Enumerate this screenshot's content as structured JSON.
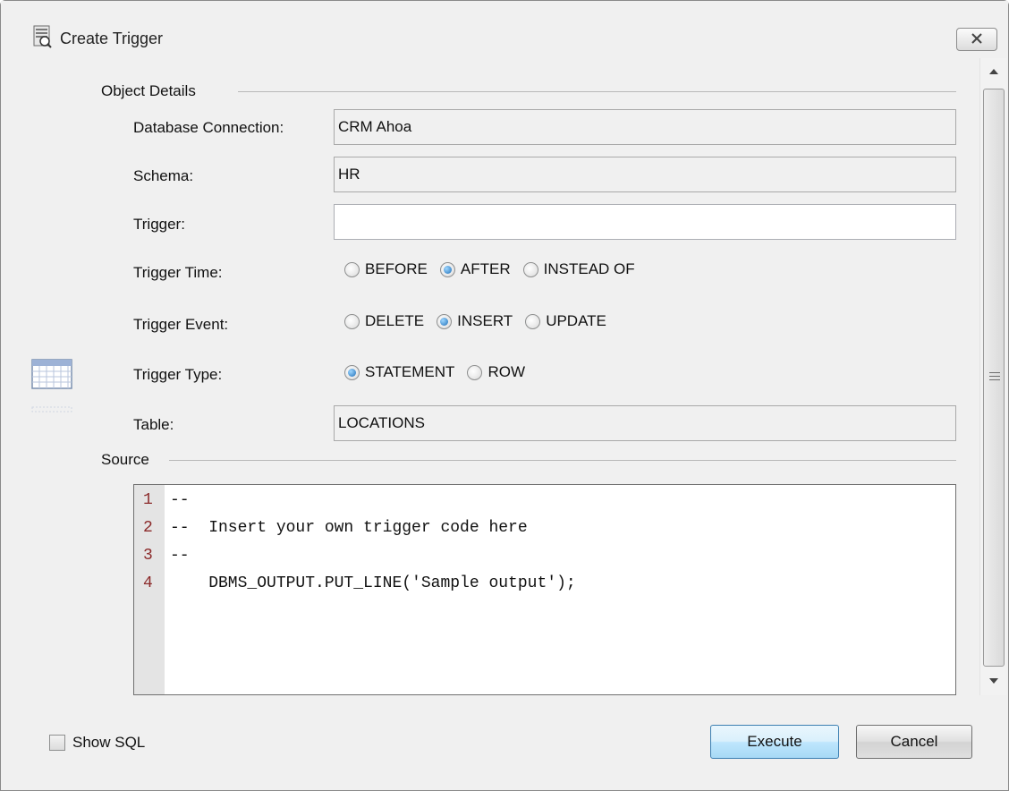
{
  "window": {
    "title": "Create Trigger"
  },
  "object_details": {
    "section_title": "Object Details",
    "database_connection": {
      "label": "Database Connection:",
      "value": "CRM Ahoa"
    },
    "schema": {
      "label": "Schema:",
      "value": "HR"
    },
    "trigger": {
      "label": "Trigger:",
      "value": ""
    },
    "trigger_time": {
      "label": "Trigger Time:",
      "options": [
        "BEFORE",
        "AFTER",
        "INSTEAD OF"
      ],
      "selected": "AFTER"
    },
    "trigger_event": {
      "label": "Trigger Event:",
      "options": [
        "DELETE",
        "INSERT",
        "UPDATE"
      ],
      "selected": "INSERT"
    },
    "trigger_type": {
      "label": "Trigger Type:",
      "options": [
        "STATEMENT",
        "ROW"
      ],
      "selected": "STATEMENT"
    },
    "table": {
      "label": "Table:",
      "value": "LOCATIONS"
    }
  },
  "source": {
    "section_title": "Source",
    "lines": [
      {
        "num": "1",
        "text": "--"
      },
      {
        "num": "2",
        "text": "--  Insert your own trigger code here"
      },
      {
        "num": "3",
        "text": "--"
      },
      {
        "num": "4",
        "text": "    DBMS_OUTPUT.PUT_LINE('Sample output');"
      }
    ]
  },
  "footer": {
    "show_sql_label": "Show SQL",
    "show_sql_checked": false,
    "execute_label": "Execute",
    "cancel_label": "Cancel"
  },
  "icons": {
    "title": "trigger-icon",
    "close": "close-icon",
    "side": "table-icon",
    "scroll_up": "arrow-up-icon",
    "scroll_down": "arrow-down-icon"
  }
}
